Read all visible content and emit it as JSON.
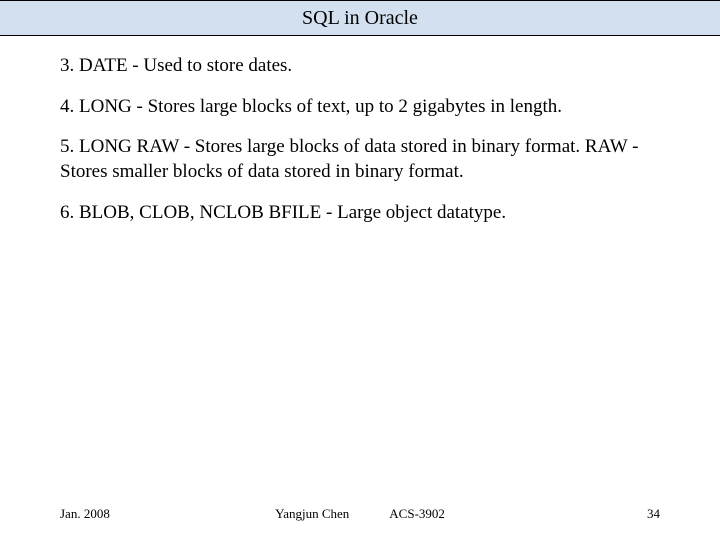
{
  "header": {
    "title": "SQL in Oracle"
  },
  "content": {
    "items": [
      "3. DATE - Used to store dates.",
      "4. LONG - Stores large blocks of text, up to 2 gigabytes in length.",
      "5. LONG RAW - Stores large blocks of data stored in binary format. RAW - Stores smaller blocks of data stored in binary format.",
      "6. BLOB, CLOB, NCLOB BFILE - Large object datatype."
    ]
  },
  "footer": {
    "date": "Jan. 2008",
    "author": "Yangjun Chen",
    "course": "ACS-3902",
    "page": "34"
  }
}
